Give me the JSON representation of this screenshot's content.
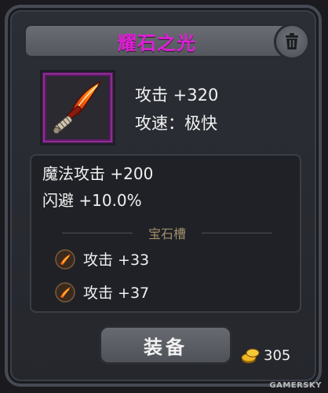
{
  "item": {
    "name": "耀石之光",
    "rarity_color": "#e01fd6",
    "icon": "fire-dagger-icon"
  },
  "base_stats": [
    "攻击 +320",
    "攻速：极快"
  ],
  "extra_stats": [
    "魔法攻击 +200",
    "闪避 +10.0%"
  ],
  "gem_slots": {
    "title": "宝石槽",
    "gems": [
      {
        "label": "攻击 +33",
        "icon": "fire-gem-icon"
      },
      {
        "label": "攻击 +37",
        "icon": "fire-gem-icon"
      }
    ]
  },
  "actions": {
    "equip_label": "装备",
    "delete_icon": "trash-icon"
  },
  "currency": {
    "icon": "gold-coin-icon",
    "amount": "305"
  },
  "watermark": "GAMERSKY"
}
